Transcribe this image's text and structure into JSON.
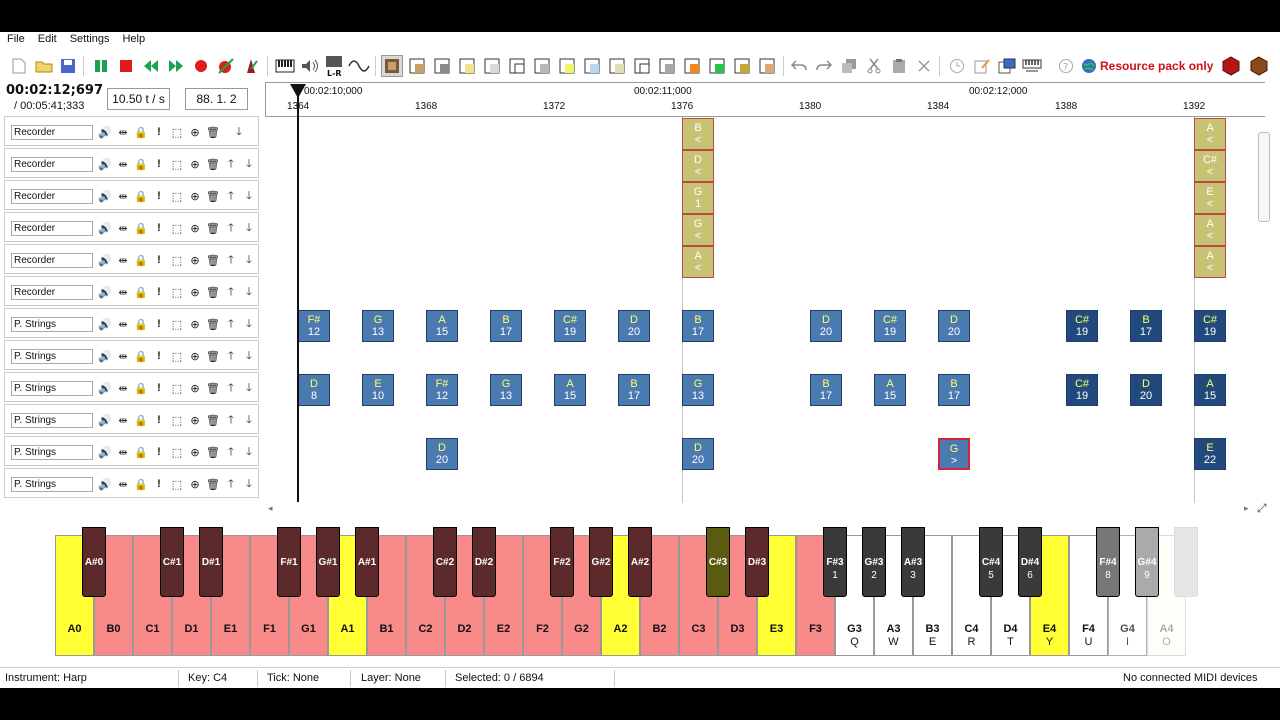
{
  "menu": [
    "File",
    "Edit",
    "Settings",
    "Help"
  ],
  "toolbar": {
    "resource_pack_label": "Resource pack only",
    "icons": [
      "new-file-icon",
      "open-folder-icon",
      "save-icon",
      "pause-icon",
      "stop-icon",
      "rewind-icon",
      "fast-forward-icon",
      "record-icon",
      "record-note-icon",
      "metronome-icon",
      "piano-icon",
      "volume-icon",
      "loop-lr-icon",
      "wave-icon",
      "instrument-icon",
      "undo-icon",
      "redo-icon",
      "copy-icon",
      "cut-icon",
      "paste-icon",
      "delete-icon",
      "clock-icon",
      "edit-icon",
      "export-icon",
      "midi-icon",
      "help-icon",
      "globe-icon"
    ]
  },
  "time": {
    "current": "00:02:12;697",
    "total": "/ 00:05:41;333",
    "tempo": "10.50 t / s",
    "position": "88. 1. 2"
  },
  "ruler": {
    "timestamps": [
      "00:02:10;000",
      "00:02:11;000",
      "00:02:12;000"
    ],
    "ticks": [
      "1364",
      "1368",
      "1372",
      "1376",
      "1380",
      "1384",
      "1388",
      "1392"
    ]
  },
  "layers": [
    {
      "name": "Recorder"
    },
    {
      "name": "Recorder"
    },
    {
      "name": "Recorder"
    },
    {
      "name": "Recorder"
    },
    {
      "name": "Recorder"
    },
    {
      "name": "Recorder"
    },
    {
      "name": "P. Strings"
    },
    {
      "name": "P. Strings"
    },
    {
      "name": "P. Strings"
    },
    {
      "name": "P. Strings"
    },
    {
      "name": "P. Strings"
    },
    {
      "name": "P. Strings"
    }
  ],
  "notes": [
    {
      "row": 0,
      "tick": 1376,
      "key": "B",
      "vel": "<",
      "style": "rec"
    },
    {
      "row": 1,
      "tick": 1376,
      "key": "D",
      "vel": "<",
      "style": "rec"
    },
    {
      "row": 2,
      "tick": 1376,
      "key": "G",
      "vel": "1",
      "style": "rec"
    },
    {
      "row": 3,
      "tick": 1376,
      "key": "G",
      "vel": "<",
      "style": "rec"
    },
    {
      "row": 4,
      "tick": 1376,
      "key": "A",
      "vel": "<",
      "style": "rec"
    },
    {
      "row": 0,
      "tick": 1392,
      "key": "A",
      "vel": "<",
      "style": "rec"
    },
    {
      "row": 1,
      "tick": 1392,
      "key": "C#",
      "vel": "<",
      "style": "rec"
    },
    {
      "row": 2,
      "tick": 1392,
      "key": "E",
      "vel": "<",
      "style": "rec"
    },
    {
      "row": 3,
      "tick": 1392,
      "key": "A",
      "vel": "<",
      "style": "rec"
    },
    {
      "row": 4,
      "tick": 1392,
      "key": "A",
      "vel": "<",
      "style": "rec"
    },
    {
      "row": 6,
      "tick": 1364,
      "key": "F#",
      "vel": "12",
      "style": "str"
    },
    {
      "row": 6,
      "tick": 1366,
      "key": "G",
      "vel": "13",
      "style": "str"
    },
    {
      "row": 6,
      "tick": 1368,
      "key": "A",
      "vel": "15",
      "style": "str"
    },
    {
      "row": 6,
      "tick": 1370,
      "key": "B",
      "vel": "17",
      "style": "str"
    },
    {
      "row": 6,
      "tick": 1372,
      "key": "C#",
      "vel": "19",
      "style": "str"
    },
    {
      "row": 6,
      "tick": 1374,
      "key": "D",
      "vel": "20",
      "style": "str"
    },
    {
      "row": 6,
      "tick": 1376,
      "key": "B",
      "vel": "17",
      "style": "str"
    },
    {
      "row": 6,
      "tick": 1380,
      "key": "D",
      "vel": "20",
      "style": "str"
    },
    {
      "row": 6,
      "tick": 1382,
      "key": "C#",
      "vel": "19",
      "style": "str"
    },
    {
      "row": 6,
      "tick": 1384,
      "key": "D",
      "vel": "20",
      "style": "str"
    },
    {
      "row": 6,
      "tick": 1388,
      "key": "C#",
      "vel": "19",
      "style": "dark"
    },
    {
      "row": 6,
      "tick": 1390,
      "key": "B",
      "vel": "17",
      "style": "dark"
    },
    {
      "row": 6,
      "tick": 1392,
      "key": "C#",
      "vel": "19",
      "style": "dark"
    },
    {
      "row": 8,
      "tick": 1364,
      "key": "D",
      "vel": "8",
      "style": "str"
    },
    {
      "row": 8,
      "tick": 1366,
      "key": "E",
      "vel": "10",
      "style": "str"
    },
    {
      "row": 8,
      "tick": 1368,
      "key": "F#",
      "vel": "12",
      "style": "str"
    },
    {
      "row": 8,
      "tick": 1370,
      "key": "G",
      "vel": "13",
      "style": "str"
    },
    {
      "row": 8,
      "tick": 1372,
      "key": "A",
      "vel": "15",
      "style": "str"
    },
    {
      "row": 8,
      "tick": 1374,
      "key": "B",
      "vel": "17",
      "style": "str"
    },
    {
      "row": 8,
      "tick": 1376,
      "key": "G",
      "vel": "13",
      "style": "str"
    },
    {
      "row": 8,
      "tick": 1380,
      "key": "B",
      "vel": "17",
      "style": "str"
    },
    {
      "row": 8,
      "tick": 1382,
      "key": "A",
      "vel": "15",
      "style": "str"
    },
    {
      "row": 8,
      "tick": 1384,
      "key": "B",
      "vel": "17",
      "style": "str"
    },
    {
      "row": 8,
      "tick": 1388,
      "key": "C#",
      "vel": "19",
      "style": "dark"
    },
    {
      "row": 8,
      "tick": 1390,
      "key": "D",
      "vel": "20",
      "style": "dark"
    },
    {
      "row": 8,
      "tick": 1392,
      "key": "A",
      "vel": "15",
      "style": "dark"
    },
    {
      "row": 10,
      "tick": 1368,
      "key": "D",
      "vel": "20",
      "style": "str"
    },
    {
      "row": 10,
      "tick": 1376,
      "key": "D",
      "vel": "20",
      "style": "str"
    },
    {
      "row": 10,
      "tick": 1384,
      "key": "G",
      "vel": ">",
      "style": "sel"
    },
    {
      "row": 10,
      "tick": 1392,
      "key": "E",
      "vel": "22",
      "style": "dark"
    }
  ],
  "piano": {
    "white_keys": [
      {
        "label": "A0",
        "kb": "",
        "color": "#ffff33"
      },
      {
        "label": "B0",
        "kb": "",
        "color": "#f98a8a"
      },
      {
        "label": "C1",
        "kb": "",
        "color": "#f98a8a"
      },
      {
        "label": "D1",
        "kb": "",
        "color": "#f98a8a"
      },
      {
        "label": "E1",
        "kb": "",
        "color": "#f98a8a"
      },
      {
        "label": "F1",
        "kb": "",
        "color": "#f98a8a"
      },
      {
        "label": "G1",
        "kb": "",
        "color": "#f98a8a"
      },
      {
        "label": "A1",
        "kb": "",
        "color": "#ffff33"
      },
      {
        "label": "B1",
        "kb": "",
        "color": "#f98a8a"
      },
      {
        "label": "C2",
        "kb": "",
        "color": "#f98a8a"
      },
      {
        "label": "D2",
        "kb": "",
        "color": "#f98a8a"
      },
      {
        "label": "E2",
        "kb": "",
        "color": "#f98a8a"
      },
      {
        "label": "F2",
        "kb": "",
        "color": "#f98a8a"
      },
      {
        "label": "G2",
        "kb": "",
        "color": "#f98a8a"
      },
      {
        "label": "A2",
        "kb": "",
        "color": "#ffff33"
      },
      {
        "label": "B2",
        "kb": "",
        "color": "#f98a8a"
      },
      {
        "label": "C3",
        "kb": "",
        "color": "#f98a8a"
      },
      {
        "label": "D3",
        "kb": "",
        "color": "#f98a8a"
      },
      {
        "label": "E3",
        "kb": "",
        "color": "#ffff33"
      },
      {
        "label": "F3",
        "kb": "",
        "color": "#f98a8a"
      },
      {
        "label": "G3",
        "kb": "Q",
        "color": "#ffffff"
      },
      {
        "label": "A3",
        "kb": "W",
        "color": "#ffffff"
      },
      {
        "label": "B3",
        "kb": "E",
        "color": "#ffffff"
      },
      {
        "label": "C4",
        "kb": "R",
        "color": "#ffffff"
      },
      {
        "label": "D4",
        "kb": "T",
        "color": "#ffffff"
      },
      {
        "label": "E4",
        "kb": "Y",
        "color": "#ffff33"
      },
      {
        "label": "F4",
        "kb": "U",
        "color": "#ffffff"
      },
      {
        "label": "G4",
        "kb": "I",
        "color": "#ffffff"
      },
      {
        "label": "A4",
        "kb": "O",
        "color": "#ffffee"
      }
    ],
    "black_keys": [
      {
        "label": "A#0",
        "kb": "",
        "after": 0,
        "color": "#5c2a2a"
      },
      {
        "label": "C#1",
        "kb": "",
        "after": 2,
        "color": "#5c2a2a"
      },
      {
        "label": "D#1",
        "kb": "",
        "after": 3,
        "color": "#5c2a2a"
      },
      {
        "label": "F#1",
        "kb": "",
        "after": 5,
        "color": "#5c2a2a"
      },
      {
        "label": "G#1",
        "kb": "",
        "after": 6,
        "color": "#5c2a2a"
      },
      {
        "label": "A#1",
        "kb": "",
        "after": 7,
        "color": "#5c2a2a"
      },
      {
        "label": "C#2",
        "kb": "",
        "after": 9,
        "color": "#5c2a2a"
      },
      {
        "label": "D#2",
        "kb": "",
        "after": 10,
        "color": "#5c2a2a"
      },
      {
        "label": "F#2",
        "kb": "",
        "after": 12,
        "color": "#5c2a2a"
      },
      {
        "label": "G#2",
        "kb": "",
        "after": 13,
        "color": "#5c2a2a"
      },
      {
        "label": "A#2",
        "kb": "",
        "after": 14,
        "color": "#5c2a2a"
      },
      {
        "label": "C#3",
        "kb": "",
        "after": 16,
        "color": "#5a5a10"
      },
      {
        "label": "D#3",
        "kb": "",
        "after": 17,
        "color": "#5c2a2a"
      },
      {
        "label": "F#3",
        "kb": "1",
        "after": 19,
        "color": "#3a3a3a"
      },
      {
        "label": "G#3",
        "kb": "2",
        "after": 20,
        "color": "#3a3a3a"
      },
      {
        "label": "A#3",
        "kb": "3",
        "after": 21,
        "color": "#3a3a3a"
      },
      {
        "label": "C#4",
        "kb": "5",
        "after": 23,
        "color": "#3a3a3a"
      },
      {
        "label": "D#4",
        "kb": "6",
        "after": 24,
        "color": "#3a3a3a"
      },
      {
        "label": "F#4",
        "kb": "8",
        "after": 26,
        "color": "#777777"
      },
      {
        "label": "G#4",
        "kb": "9",
        "after": 27,
        "color": "#aaaaaa"
      },
      {
        "label": "",
        "kb": "",
        "after": 28,
        "color": "#e6e6e6"
      }
    ]
  },
  "status": {
    "instrument": "Instrument: Harp",
    "key": "Key: C4",
    "tick": "Tick: None",
    "layer": "Layer: None",
    "selected": "Selected: 0 / 6894",
    "midi": "No connected MIDI devices"
  },
  "colors": {
    "note_blue": "#4a7ab0",
    "note_dark": "#1f4a7a",
    "note_recorder": "#c8c275",
    "accent_red": "#d0101a"
  }
}
